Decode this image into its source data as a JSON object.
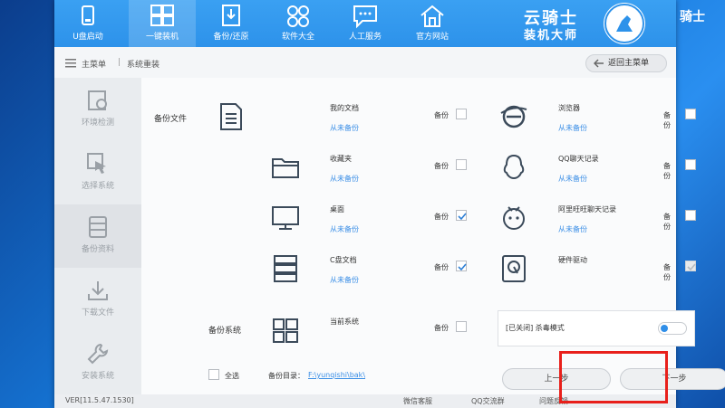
{
  "nav": [
    {
      "label": "U盘启动",
      "icon": "usb-icon"
    },
    {
      "label": "一键装机",
      "icon": "grid-icon"
    },
    {
      "label": "备份/还原",
      "icon": "backup-icon"
    },
    {
      "label": "软件大全",
      "icon": "apps-icon"
    },
    {
      "label": "人工服务",
      "icon": "chat-icon"
    },
    {
      "label": "官方网站",
      "icon": "home-icon"
    }
  ],
  "brand": {
    "line1": "云骑士",
    "line2": "装机大师",
    "corner": "骑士"
  },
  "breadcrumb": {
    "home": "主菜单",
    "sep": "|",
    "current": "系统重装"
  },
  "back_button": "返回主菜单",
  "steps": [
    {
      "label": "环境检测"
    },
    {
      "label": "选择系统"
    },
    {
      "label": "备份资料"
    },
    {
      "label": "下载文件"
    },
    {
      "label": "安装系统"
    }
  ],
  "backup_files_label": "备份文件",
  "backup_system_label": "备份系统",
  "backup_label": "备份",
  "items_left": [
    {
      "name": "我的文档",
      "sub": "从未备份",
      "checked": false
    },
    {
      "name": "收藏夹",
      "sub": "从未备份",
      "checked": false
    },
    {
      "name": "桌面",
      "sub": "从未备份",
      "checked": true
    },
    {
      "name": "C盘文档",
      "sub": "从未备份",
      "checked": true
    }
  ],
  "items_right": [
    {
      "name": "浏览器",
      "sub": "从未备份",
      "checked": false
    },
    {
      "name": "QQ聊天记录",
      "sub": "从未备份",
      "checked": false
    },
    {
      "name": "阿里旺旺聊天记录",
      "sub": "从未备份",
      "checked": false
    },
    {
      "name": "硬件驱动",
      "sub": "",
      "checked": true
    }
  ],
  "current_system": {
    "name": "当前系统",
    "checked": false
  },
  "antivirus": "[已关闭] 杀毒模式",
  "select_all": "全选",
  "backup_dir_label": "备份目录：",
  "backup_dir_value": "F:\\yunqishi\\bak\\",
  "prev_button": "上一步",
  "next_button": "下一步",
  "footer": {
    "version": "VER[11.5.47.1530]",
    "link1": "微信客服",
    "link2": "QQ交流群",
    "link3": "问题反馈"
  },
  "colors": {
    "accent": "#2d92ea",
    "link": "#3a8ee6",
    "highlight": "#e8201b"
  }
}
